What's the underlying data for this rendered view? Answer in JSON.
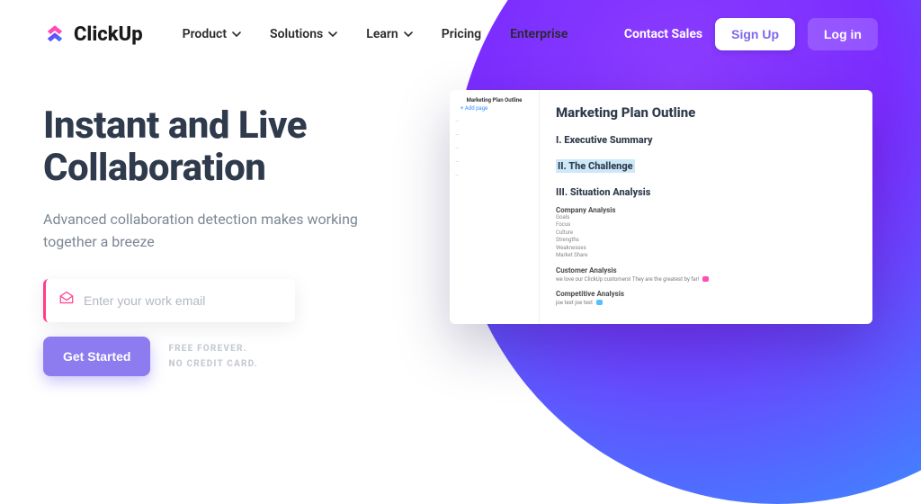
{
  "brand": {
    "name": "ClickUp"
  },
  "nav": {
    "links": [
      "Product",
      "Solutions",
      "Learn",
      "Pricing",
      "Enterprise"
    ],
    "contact_sales": "Contact Sales",
    "signup": "Sign Up",
    "login": "Log in"
  },
  "hero": {
    "title_1": "Instant and Live",
    "title_2": "Collaboration",
    "subtitle": "Advanced collaboration detection makes working together a breeze",
    "email_placeholder": "Enter your work email",
    "cta": "Get Started",
    "free_1": "FREE FOREVER.",
    "free_2": "NO CREDIT CARD."
  },
  "preview": {
    "sidebar_title": "Marketing Plan Outline",
    "sidebar_add": "+ Add page",
    "doc_title": "Marketing Plan Outline",
    "sections": {
      "s1": "I. Executive Summary",
      "s2": "II. The Challenge",
      "s3": "III. Situation Analysis"
    },
    "company_analysis": {
      "heading": "Company Analysis",
      "items": [
        "Goals",
        "Focus",
        "Culture",
        "Strengths",
        "Weaknesses",
        "Market Share"
      ]
    },
    "customer_analysis": {
      "heading": "Customer Analysis",
      "line": "we love our ClickUp customers! They are the greatest by far!"
    },
    "competitive_analysis": {
      "heading": "Competitive Analysis",
      "line": "joe test joe test"
    }
  }
}
